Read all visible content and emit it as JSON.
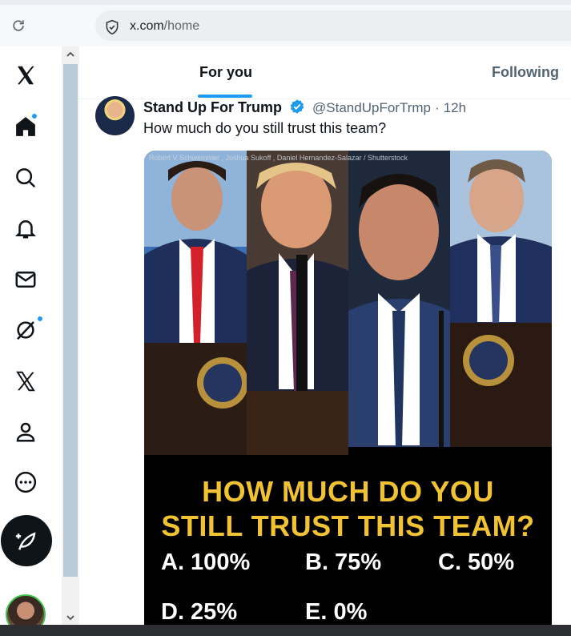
{
  "browser": {
    "url_host": "x.com",
    "url_path": "/home"
  },
  "nav": {
    "items": [
      {
        "name": "x-logo-icon"
      },
      {
        "name": "home-icon"
      },
      {
        "name": "search-icon"
      },
      {
        "name": "notifications-icon"
      },
      {
        "name": "messages-icon"
      },
      {
        "name": "grok-icon"
      },
      {
        "name": "premium-x-icon"
      },
      {
        "name": "profile-icon"
      },
      {
        "name": "more-icon"
      }
    ]
  },
  "tabs": {
    "for_you": "For you",
    "following": "Following"
  },
  "tweet": {
    "author": "Stand Up For Trump",
    "handle": "@StandUpForTrmp",
    "separator": "·",
    "time": "12h",
    "text": "How much do you still trust this team?",
    "media": {
      "credit": "Robert V Schwemmer , Joshua Sukoff , Daniel Hernandez-Salazar / Shutterstock",
      "title_line1": "HOW MUCH DO YOU",
      "title_line2": "STILL TRUST THIS TEAM?",
      "options": {
        "a": "A. 100%",
        "b": "B. 75%",
        "c": "C. 50%",
        "d": "D. 25%",
        "e": "E. 0%"
      }
    }
  },
  "colors": {
    "accent": "#1d9bf0",
    "poll_title": "#f1c232"
  }
}
